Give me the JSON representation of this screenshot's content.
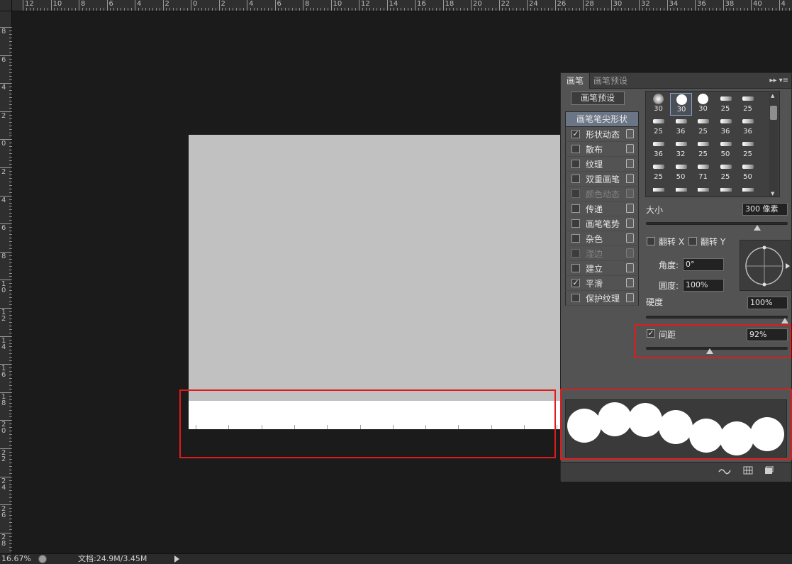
{
  "rulers": {
    "top": [
      "12",
      "10",
      "8",
      "6",
      "4",
      "2",
      "0",
      "2",
      "4",
      "6",
      "8",
      "10",
      "12",
      "14",
      "16",
      "18",
      "20",
      "22",
      "24",
      "26",
      "28",
      "30",
      "32",
      "34",
      "36",
      "38",
      "40",
      "4"
    ],
    "left": [
      "8",
      "6",
      "4",
      "2",
      "0",
      "2",
      "4",
      "6",
      "8",
      "1\n0",
      "1\n2",
      "1\n4",
      "1\n6",
      "1\n8",
      "2\n0",
      "2\n2",
      "2\n4",
      "2\n6",
      "2\n8"
    ]
  },
  "panel": {
    "tabs": [
      {
        "label": "画笔",
        "active": true
      },
      {
        "label": "画笔预设",
        "active": false
      }
    ],
    "tab_menu_icons": [
      "▸▸",
      "▾≡"
    ],
    "brush_presets_button": "画笔预设",
    "brush_tip_shape": "画笔笔尖形状",
    "options": [
      {
        "label": "形状动态",
        "checked": true,
        "disabled": false
      },
      {
        "label": "散布",
        "checked": false,
        "disabled": false
      },
      {
        "label": "纹理",
        "checked": false,
        "disabled": false
      },
      {
        "label": "双重画笔",
        "checked": false,
        "disabled": false
      },
      {
        "label": "颜色动态",
        "checked": false,
        "disabled": true
      },
      {
        "label": "传递",
        "checked": false,
        "disabled": false
      },
      {
        "label": "画笔笔势",
        "checked": false,
        "disabled": false
      },
      {
        "label": "杂色",
        "checked": false,
        "disabled": false
      },
      {
        "label": "湿边",
        "checked": false,
        "disabled": true
      },
      {
        "label": "建立",
        "checked": false,
        "disabled": false
      },
      {
        "label": "平滑",
        "checked": true,
        "disabled": false
      },
      {
        "label": "保护纹理",
        "checked": false,
        "disabled": false
      }
    ],
    "brush_sizes": [
      "30",
      "30",
      "30",
      "25",
      "25",
      "25",
      "36",
      "25",
      "36",
      "36",
      "36",
      "32",
      "25",
      "50",
      "25",
      "25",
      "50",
      "71",
      "25",
      "50"
    ],
    "size_label": "大小",
    "size_value": "300 像素",
    "flip_x_label": "翻转 X",
    "flip_y_label": "翻转 Y",
    "angle_label": "角度:",
    "angle_value": "0°",
    "roundness_label": "圆度:",
    "roundness_value": "100%",
    "hardness_label": "硬度",
    "hardness_value": "100%",
    "spacing_label": "间距",
    "spacing_value": "92%",
    "spacing_checked": true,
    "size_slider_fraction": 0.8,
    "hardness_slider_fraction": 1.0,
    "spacing_slider_fraction": 0.46
  },
  "status": {
    "zoom": "16.67%",
    "doc": "文档:24.9M/3.45M"
  },
  "colors": {
    "highlight": "#e11b1b",
    "canvas_gray": "#c1c1c1"
  }
}
